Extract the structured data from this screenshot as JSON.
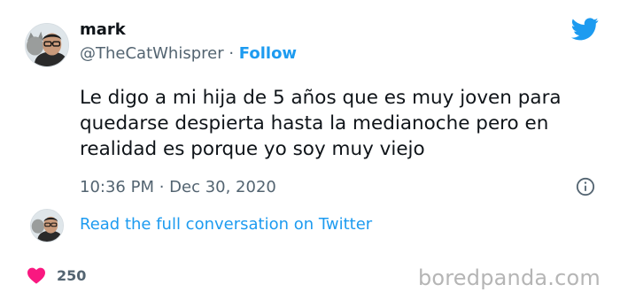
{
  "user": {
    "name": "mark",
    "handle": "@TheCatWhisprer",
    "separator": " · ",
    "follow_label": "Follow"
  },
  "tweet": {
    "text": "Le digo a mi hija de 5 años que es muy joven para quedarse despierta hasta la medianoche pero en realidad es porque yo soy muy viejo",
    "timestamp": "10:36 PM · Dec 30, 2020"
  },
  "conversation": {
    "link_label": "Read the full conversation on Twitter"
  },
  "engagement": {
    "likes": "250"
  },
  "watermark": "boredpanda.com",
  "icons": {
    "brand": "twitter-bird-icon",
    "info": "info-icon",
    "like": "heart-icon"
  },
  "colors": {
    "accent": "#1d9bf0",
    "heart": "#f91880",
    "text": "#0f1419",
    "secondary": "#536471"
  }
}
